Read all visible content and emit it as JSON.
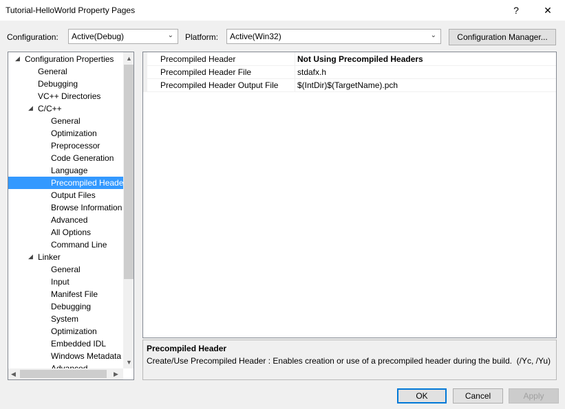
{
  "window": {
    "title": "Tutorial-HelloWorld Property Pages",
    "help_glyph": "?",
    "close_glyph": "✕"
  },
  "toolbar": {
    "configuration_label": "Configuration:",
    "configuration_value": "Active(Debug)",
    "platform_label": "Platform:",
    "platform_value": "Active(Win32)",
    "config_manager_label": "Configuration Manager..."
  },
  "tree": {
    "items": [
      {
        "label": "Configuration Properties",
        "expander": "◢"
      },
      {
        "label": "General"
      },
      {
        "label": "Debugging"
      },
      {
        "label": "VC++ Directories"
      },
      {
        "label": "C/C++",
        "expander": "◢"
      },
      {
        "label": "General"
      },
      {
        "label": "Optimization"
      },
      {
        "label": "Preprocessor"
      },
      {
        "label": "Code Generation"
      },
      {
        "label": "Language"
      },
      {
        "label": "Precompiled Heade"
      },
      {
        "label": "Output Files"
      },
      {
        "label": "Browse Information"
      },
      {
        "label": "Advanced"
      },
      {
        "label": "All Options"
      },
      {
        "label": "Command Line"
      },
      {
        "label": "Linker",
        "expander": "◢"
      },
      {
        "label": "General"
      },
      {
        "label": "Input"
      },
      {
        "label": "Manifest File"
      },
      {
        "label": "Debugging"
      },
      {
        "label": "System"
      },
      {
        "label": "Optimization"
      },
      {
        "label": "Embedded IDL"
      },
      {
        "label": "Windows Metadata"
      },
      {
        "label": "Advanced"
      }
    ]
  },
  "properties": [
    {
      "name": "Precompiled Header",
      "value": "Not Using Precompiled Headers"
    },
    {
      "name": "Precompiled Header File",
      "value": "stdafx.h"
    },
    {
      "name": "Precompiled Header Output File",
      "value": "$(IntDir)$(TargetName).pch"
    }
  ],
  "description": {
    "title": "Precompiled Header",
    "text": "Create/Use Precompiled Header : Enables creation or use of a precompiled header during the build.",
    "switch_hint": "(/Yc, /Yu)"
  },
  "buttons": {
    "ok": "OK",
    "cancel": "Cancel",
    "apply": "Apply"
  },
  "scroll": {
    "up": "▲",
    "down": "▼",
    "left": "◀",
    "right": "▶"
  },
  "colors": {
    "selection": "#3399ff",
    "default_button_border": "#0078d7"
  }
}
